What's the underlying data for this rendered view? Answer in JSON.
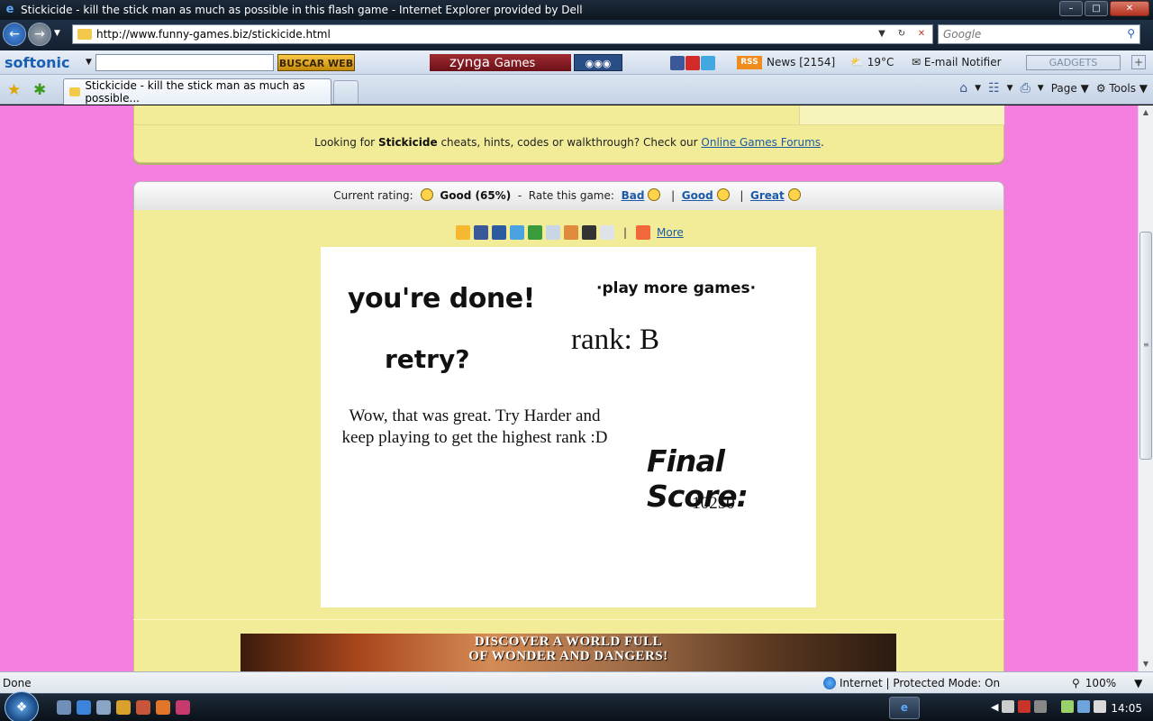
{
  "window": {
    "title": "Stickicide - kill the stick man as much as possible in this flash game - Internet Explorer provided by Dell",
    "min_glyph": "–",
    "max_glyph": "□",
    "close_glyph": "✕"
  },
  "address": {
    "url": "http://www.funny-games.biz/stickicide.html",
    "search_placeholder": "Google"
  },
  "toolbar": {
    "softonic": "softonic",
    "buscar": "BUSCAR WEB",
    "zynga": "zynga",
    "zynga_games": "Games",
    "rss": "RSS",
    "news": "News [2154]",
    "weather": "19°C",
    "email": "E-mail Notifier",
    "gadgets": "GADGETS"
  },
  "tabs": {
    "active_label": "Stickicide - kill the stick man as much as possible...",
    "page_label": "Page",
    "tools_label": "Tools"
  },
  "page": {
    "cheats_prefix": "Looking for",
    "cheats_game": "Stickicide",
    "cheats_middle": "cheats, hints, codes or walkthrough? Check our",
    "cheats_link": "Online Games Forums",
    "cheats_suffix": ".",
    "rating_label": "Current rating:",
    "rating_value": "Good (65%)",
    "rating_sep": "-",
    "rate_label": "Rate this game:",
    "rate_bad": "Bad",
    "rate_good": "Good",
    "rate_great": "Great",
    "pipe": "|",
    "share_more": "More"
  },
  "game": {
    "done": "you're done!",
    "play_more": "·play more games·",
    "rank": "rank: B",
    "retry": "retry?",
    "message": "Wow, that was great. Try Harder and keep playing to get the highest rank :D",
    "final_label": "Final Score:",
    "final_score": "10250"
  },
  "banner": {
    "line1": "DISCOVER A WORLD FULL",
    "line2": "OF WONDER AND DANGERS!"
  },
  "status": {
    "text": "Done",
    "zone": "Internet | Protected Mode: On",
    "zoom": "100%"
  },
  "taskbar": {
    "clock": "14:05"
  },
  "colors": {
    "page_bg": "#f47fe0",
    "panel_bg": "#f2ec98",
    "link": "#1b5aa8"
  }
}
